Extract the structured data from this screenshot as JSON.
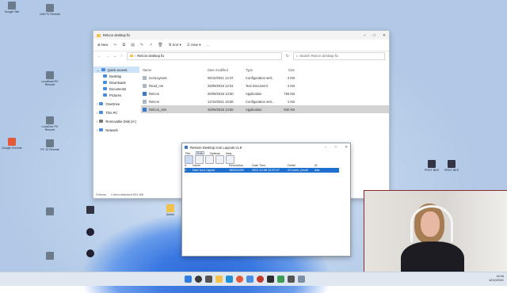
{
  "desktop_icons": [
    {
      "label": "Google Site",
      "icon": "doc-icon"
    },
    {
      "label": "Unit PC Remote",
      "icon": "app-icon"
    },
    {
      "label": "Localhost PC Remote",
      "icon": "app-icon"
    },
    {
      "label": "LocalDev PC Remote",
      "icon": "app-icon"
    },
    {
      "label": "Google Chrome",
      "icon": "chrome-icon"
    },
    {
      "label": "PC 10 Remote",
      "icon": "app-icon"
    },
    {
      "label": "",
      "icon": "app-icon"
    },
    {
      "label": "",
      "icon": "camera-icon"
    },
    {
      "label": "",
      "icon": "app-icon"
    },
    {
      "label": "",
      "icon": "app-icon"
    },
    {
      "label": "",
      "icon": "app-icon"
    },
    {
      "label": "Adobe",
      "icon": "folder-icon"
    },
    {
      "label": "PROT BES",
      "icon": "app-icon"
    },
    {
      "label": "PROT BES",
      "icon": "app-icon"
    }
  ],
  "explorer": {
    "title": "Relcon desktop fix",
    "toolbar": {
      "new": "New",
      "sort": "Sort",
      "view": "View",
      "more": "···"
    },
    "address": "Relcon desktop fix",
    "search_placeholder": "Search Relcon desktop fix",
    "nav": [
      {
        "label": "Quick access",
        "selected": true
      },
      {
        "label": "Desktop"
      },
      {
        "label": "Downloads"
      },
      {
        "label": "Documents"
      },
      {
        "label": "Pictures"
      },
      {
        "label": "OneDrive"
      },
      {
        "label": "This PC"
      },
      {
        "label": "Removable Disk (H:)"
      },
      {
        "label": "Network"
      }
    ],
    "columns": [
      "Name",
      "Date modified",
      "Type",
      "Size"
    ],
    "files": [
      {
        "name": "IconLayouts",
        "date": "06/10/2021 12:37",
        "type": "Configuration sett...",
        "size": "2 KB"
      },
      {
        "name": "Read_me",
        "date": "25/09/2018 12:51",
        "type": "Text Document",
        "size": "4 KB"
      },
      {
        "name": "Relcon",
        "date": "25/09/2018 13:50",
        "type": "Application",
        "size": "784 KB"
      },
      {
        "name": "Relcon",
        "date": "12/10/2021 16:56",
        "type": "Configuration sett...",
        "size": "1 KB"
      },
      {
        "name": "Relcon_x64",
        "date": "25/09/2018 13:50",
        "type": "Application",
        "size": "932 KB",
        "selected": true
      }
    ],
    "status_items": "3 items",
    "status_selected": "1 item selected 931 KB"
  },
  "dialog": {
    "title": "Restore Desktop Icon Layouts v1.9",
    "menu": [
      "File",
      "Edit",
      "Options",
      "Help"
    ],
    "columns": [
      "#",
      "Name",
      "Resolution",
      "Date Time",
      "Detail",
      "ID"
    ],
    "row": {
      "num": "1",
      "name": "New Icon Layout",
      "resolution": "1600x1200",
      "datetime": "2021.10.08 12:57:27",
      "detail": "22 icons, (multi",
      "id": "d4a"
    }
  },
  "tray": {
    "time": "16:34",
    "date": "12/10/2021"
  },
  "colors": {
    "accent": "#1f6fce",
    "selection": "#cde3f7",
    "webcam_border": "#8c2a2a"
  }
}
